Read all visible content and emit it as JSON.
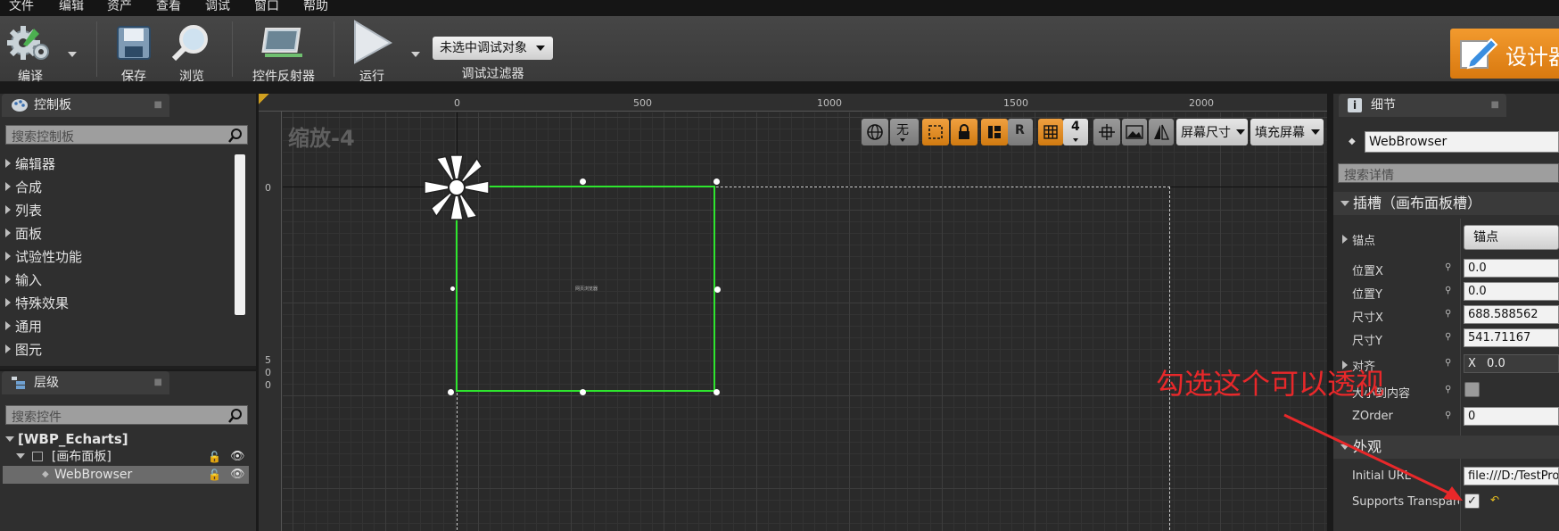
{
  "menu": [
    "文件",
    "编辑",
    "资产",
    "查看",
    "调试",
    "窗口",
    "帮助"
  ],
  "toolbar": {
    "compile_label": "编译",
    "save_label": "保存",
    "browse_label": "浏览",
    "widget_reflector_label": "控件反射器",
    "play_label": "运行",
    "debug_object_select": "未选中调试对象",
    "debug_filter_label": "调试过滤器",
    "designer_label": "设计器"
  },
  "palette": {
    "tab_label": "控制板",
    "search_placeholder": "搜索控制板",
    "categories": [
      "编辑器",
      "合成",
      "列表",
      "面板",
      "试验性功能",
      "输入",
      "特殊效果",
      "通用",
      "图元"
    ]
  },
  "hierarchy": {
    "tab_label": "层级",
    "search_placeholder": "搜索控件",
    "root": "[WBP_Echarts]",
    "canvas_panel": "[画布面板]",
    "selected_widget": "WebBrowser"
  },
  "canvas": {
    "zoom_label": "缩放-4",
    "ruler_top": [
      "0",
      "500",
      "1000",
      "1500",
      "2000"
    ],
    "ruler_left_0": "0",
    "ruler_left_500": [
      "5",
      "0",
      "0"
    ],
    "widget_text": "网页浏览器",
    "toolbar": {
      "none_label": "无",
      "r_label": "R",
      "grid_size": "4",
      "screen_size_label": "屏幕尺寸",
      "fill_screen_label": "填充屏幕"
    }
  },
  "details": {
    "tab_label": "细节",
    "widget_name": "WebBrowser",
    "search_placeholder": "搜索详情",
    "slot_section": "插槽（画布面板槽）",
    "anchors_label": "锚点",
    "anchors_value": "锚点",
    "position_x_label": "位置X",
    "position_x_value": "0.0",
    "position_y_label": "位置Y",
    "position_y_value": "0.0",
    "size_x_label": "尺寸X",
    "size_x_value": "688.588562",
    "size_y_label": "尺寸Y",
    "size_y_value": "541.71167",
    "alignment_label": "对齐",
    "alignment_x_prefix": "X",
    "alignment_x_value": "0.0",
    "size_to_content_label": "大小到内容",
    "zorder_label": "ZOrder",
    "zorder_value": "0",
    "appearance_section": "外观",
    "initial_url_label": "Initial URL",
    "initial_url_value": "file:///D:/TestProj",
    "supports_transparency_label": "Supports Transparen",
    "supports_transparency_checked": true
  },
  "annotation": {
    "text": "勾选这个可以透视",
    "color": "#e8282a"
  },
  "colors": {
    "accent_orange": "#e8890f",
    "selection_green": "#2ee62e"
  }
}
